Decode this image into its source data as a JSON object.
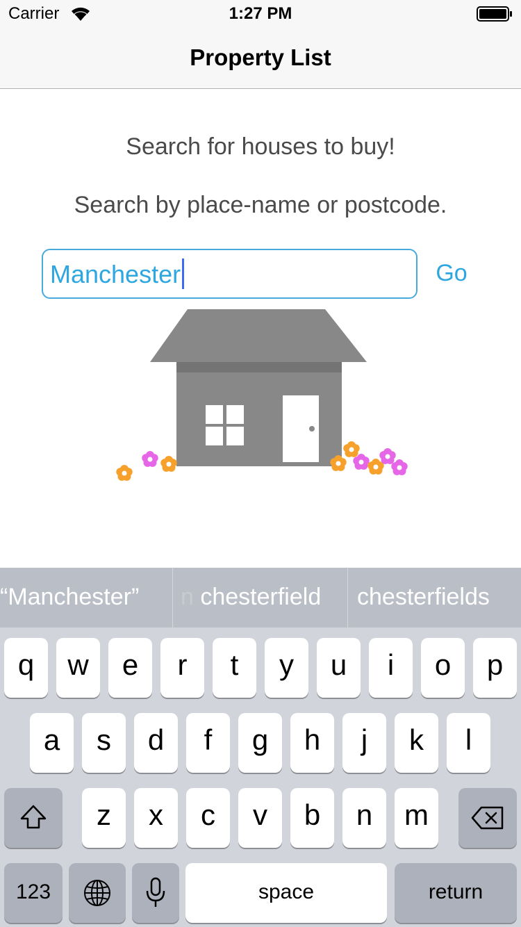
{
  "status_bar": {
    "carrier": "Carrier",
    "time": "1:27 PM"
  },
  "nav": {
    "title": "Property List"
  },
  "content": {
    "line1": "Search for houses to buy!",
    "line2": "Search by place-name or postcode.",
    "search_value": "Manchester",
    "go_label": "Go"
  },
  "keyboard": {
    "suggestions": {
      "s1": "“Manchester”",
      "s2_prefix": "n",
      "s2": " chesterfield",
      "s3": "chesterfields"
    },
    "row1": [
      "q",
      "w",
      "e",
      "r",
      "t",
      "y",
      "u",
      "i",
      "o",
      "p"
    ],
    "row2": [
      "a",
      "s",
      "d",
      "f",
      "g",
      "h",
      "j",
      "k",
      "l"
    ],
    "row3": [
      "z",
      "x",
      "c",
      "v",
      "b",
      "n",
      "m"
    ],
    "numbers_label": "123",
    "space_label": "space",
    "return_label": "return"
  },
  "icons": [
    "wifi-icon",
    "battery-icon",
    "shift-icon",
    "delete-icon",
    "globe-icon",
    "microphone-icon",
    "house-illustration"
  ],
  "colors": {
    "accent": "#2ea7e0",
    "house": "#888888"
  }
}
